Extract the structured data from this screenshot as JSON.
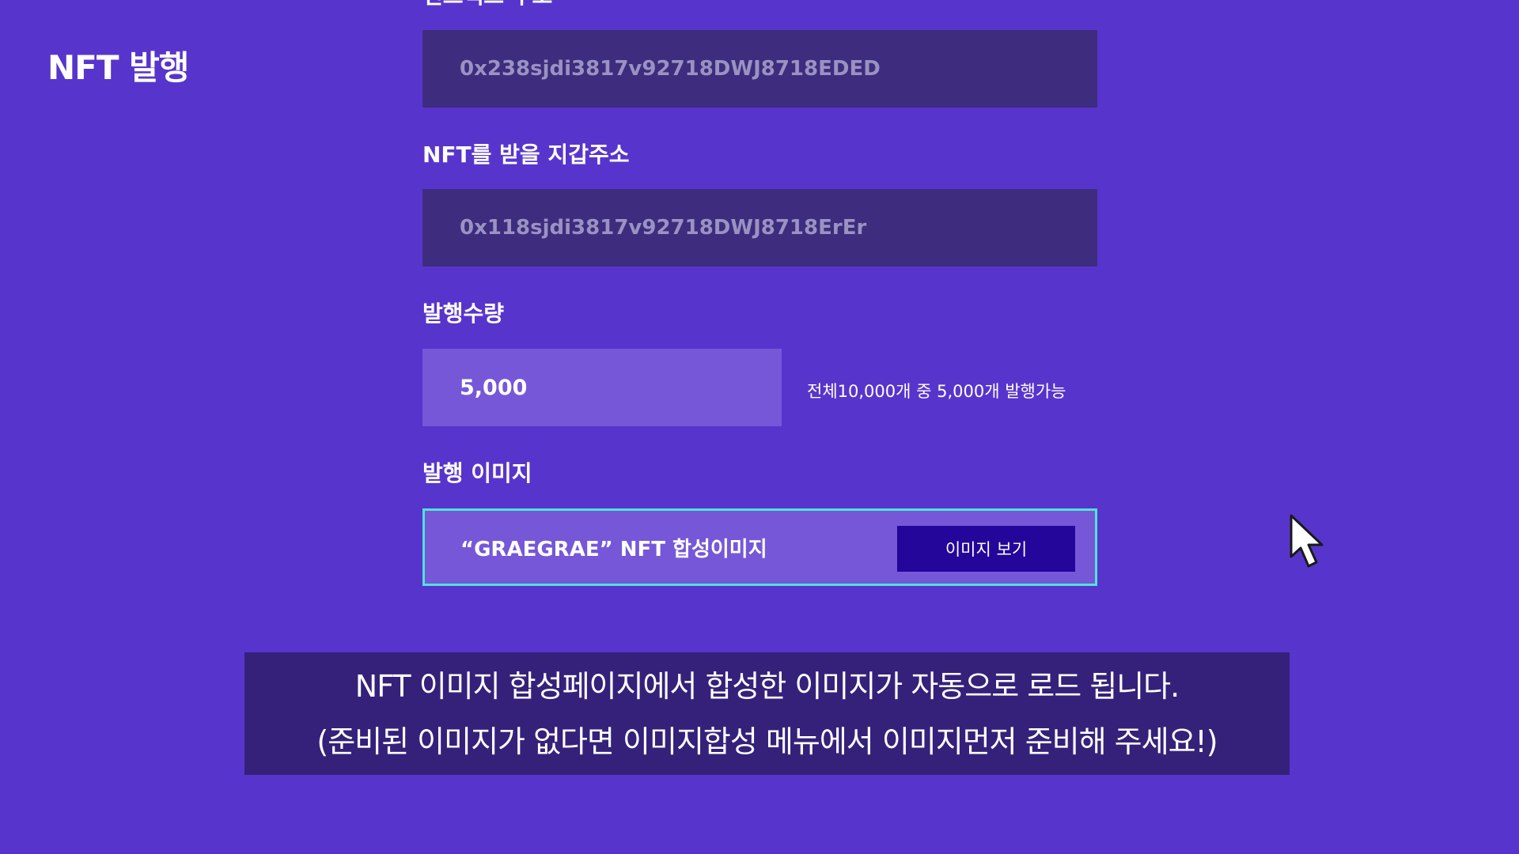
{
  "header": {
    "title": "NFT 발행"
  },
  "form": {
    "contract_label_partial": "컨트랙트 주소",
    "contract_address": "0x238sjdi3817v92718DWJ8718EDED",
    "wallet_label": "NFT를 받을 지갑주소",
    "wallet_address": "0x118sjdi3817v92718DWJ8718ErEr",
    "quantity_label": "발행수량",
    "quantity_value": "5,000",
    "quantity_hint": "전체10,000개 중 5,000개 발행가능",
    "image_label": "발행 이미지",
    "image_value": "“GRAEGRAE” NFT 합성이미지",
    "view_image_button": "이미지 보기"
  },
  "caption": {
    "line1": "NFT 이미지 합성페이지에서 합성한 이미지가 자동으로 로드 됩니다.",
    "line2": "(준비된 이미지가 없다면 이미지합성 메뉴에서 이미지먼저 준비해 주세요!)"
  },
  "colors": {
    "background": "#5735cc",
    "input_dark": "#3e2c7e",
    "input_light": "#7657d8",
    "highlight_border": "#4fe3d8",
    "button": "#24069a",
    "caption_bg": "#35217a"
  },
  "icons": {
    "cursor": "mouse-pointer-icon"
  }
}
